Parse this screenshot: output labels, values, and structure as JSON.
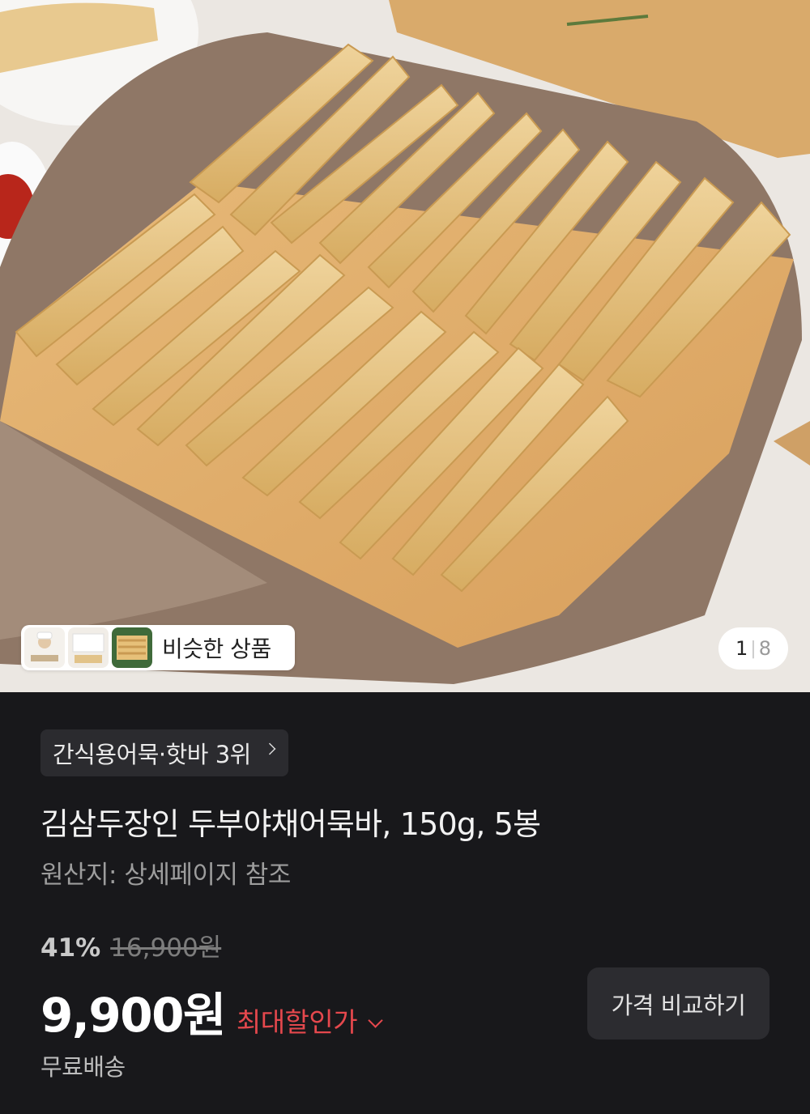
{
  "gallery": {
    "similar_label": "비슷한 상품",
    "counter_current": "1",
    "counter_total": "8"
  },
  "product": {
    "rank_chip": "간식용어묵·핫바 3위",
    "title": "김삼두장인 두부야채어묵바, 150g, 5봉",
    "origin": "원산지: 상세페이지 참조",
    "discount_percent": "41%",
    "original_price": "16,900원",
    "price": "9,900원",
    "max_discount_label": "최대할인가",
    "compare_button": "가격 비교하기",
    "shipping": "무료배송"
  },
  "colors": {
    "background": "#18181b",
    "accent_red": "#e5484d",
    "chip_bg": "#2b2b2f"
  }
}
